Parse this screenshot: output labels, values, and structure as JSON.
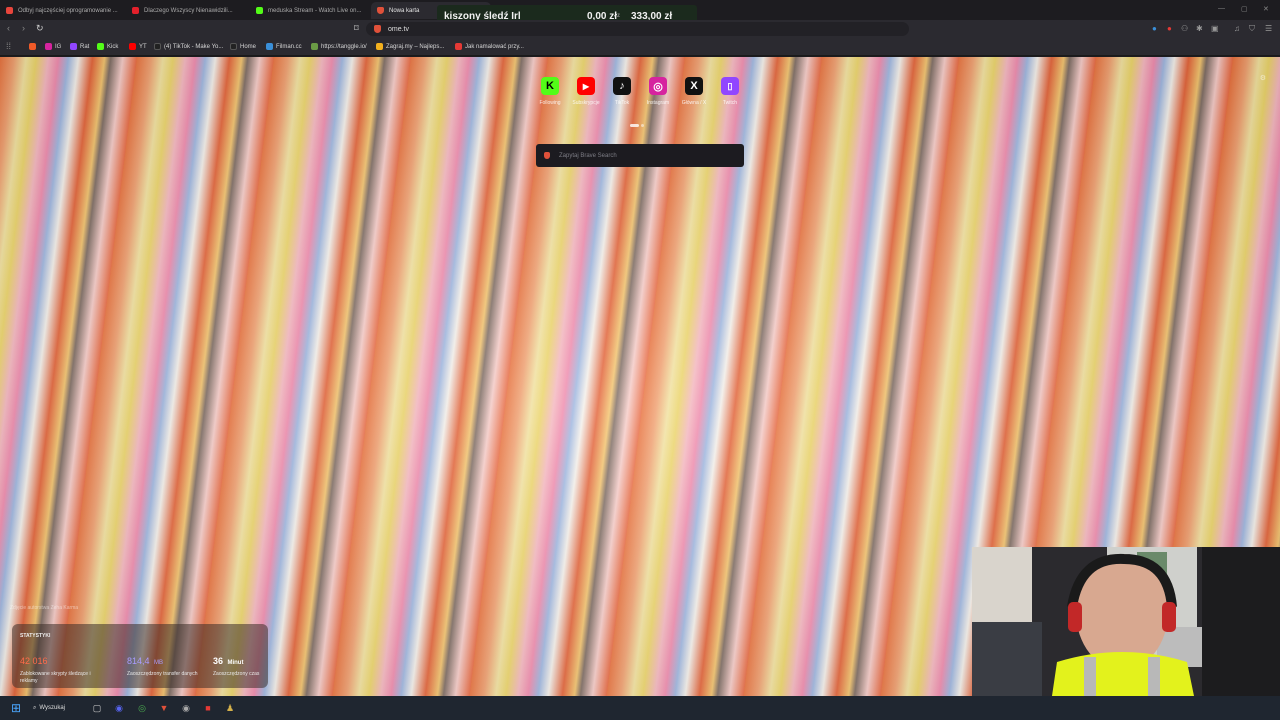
{
  "tabs": [
    {
      "label": "Odbyj najczęściej oprogramowanie ...",
      "color": "#e8453c"
    },
    {
      "label": "Dlaczego Wszyscy Nienawidzili...",
      "color": "#e3202b"
    },
    {
      "label": "meduska Stream - Watch Live on...",
      "color": "#53fc18"
    },
    {
      "label": "Nowa karta",
      "color": "#e0513a",
      "active": true
    }
  ],
  "donation_overlay": {
    "name": "kiszony śledź Irl",
    "current": "0,00 zł",
    "separator": "z",
    "goal": "333,00 zł"
  },
  "address_bar": {
    "url": "ome.tv"
  },
  "bookmarks": [
    {
      "label": "IG",
      "color": "#d6249f"
    },
    {
      "label": "Rat",
      "color": "#9146ff"
    },
    {
      "label": "Kick",
      "color": "#53fc18"
    },
    {
      "label": "YT",
      "color": "#ff0000"
    },
    {
      "label": "(4) TikTok - Make Yo...",
      "color": "#222"
    },
    {
      "label": "Home",
      "color": "#222"
    },
    {
      "label": "Filman.cc",
      "color": "#3a8fd8"
    },
    {
      "label": "https://tanggle.io/",
      "color": "#6a9b45"
    },
    {
      "label": "Zagraj.my – Najleps...",
      "color": "#f2b01e"
    },
    {
      "label": "Jak namalować przy...",
      "color": "#e53935"
    }
  ],
  "top_sites": [
    {
      "label": "Following",
      "glyph": "K",
      "bg": "#53fc18",
      "fg": "#000",
      "icon": "kick-icon"
    },
    {
      "label": "Subskrypcje",
      "glyph": "▶",
      "bg": "#ff0000",
      "fg": "#fff",
      "icon": "youtube-icon"
    },
    {
      "label": "TikTok",
      "glyph": "♪",
      "bg": "#111",
      "fg": "#fff",
      "icon": "tiktok-icon"
    },
    {
      "label": "Instagram",
      "glyph": "◎",
      "bg": "#d6249f",
      "fg": "#fff",
      "icon": "instagram-icon"
    },
    {
      "label": "Główna / X",
      "glyph": "X",
      "bg": "#111",
      "fg": "#fff",
      "icon": "x-icon"
    },
    {
      "label": "Twitch",
      "glyph": "▯",
      "bg": "#9146ff",
      "fg": "#fff",
      "icon": "twitch-icon"
    }
  ],
  "search": {
    "placeholder": "Zapytaj Brave Search"
  },
  "photo_credit": "Zdjęcie autorstwa Zeha Karma",
  "stats": {
    "title": "STATYSTYKI",
    "items": [
      {
        "value": "42 016",
        "unit": "",
        "label": "Zablokowane skrypty śledzące i reklamy",
        "color": "#ff6b4a"
      },
      {
        "value": "814,4",
        "unit": "MB",
        "label": "Zaoszczędzony transfer danych",
        "color": "#a99cff"
      },
      {
        "value": "36",
        "unit": "Minut",
        "label": "Zaoszczędzony czas",
        "color": "#ffffff"
      }
    ]
  },
  "taskbar": {
    "search_label": "Wyszukaj"
  }
}
